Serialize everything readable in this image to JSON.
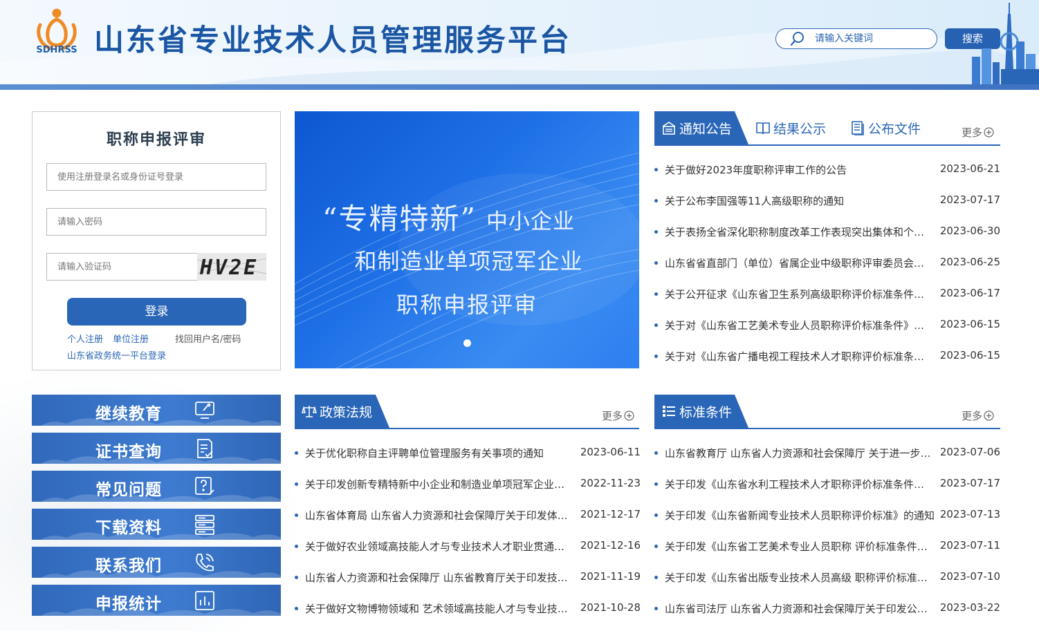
{
  "header": {
    "logo_text": "SDHRSS",
    "title": "山东省专业技术人员管理服务平台",
    "search_placeholder": "请输入关键词",
    "search_button": "搜索"
  },
  "login": {
    "title": "职称申报评审",
    "username_placeholder": "使用注册登录名或身份证号登录",
    "password_placeholder": "请输入密码",
    "captcha_placeholder": "请输入验证码",
    "captcha_text": "HV2E",
    "login_button": "登录",
    "personal_register": "个人注册",
    "unit_register": "单位注册",
    "recover": "找回用户名/密码",
    "gov_login": "山东省政务统一平台登录"
  },
  "side_nav": [
    {
      "label": "继续教育",
      "icon": "online-learning-icon"
    },
    {
      "label": "证书查询",
      "icon": "certificate-check-icon"
    },
    {
      "label": "常见问题",
      "icon": "question-edit-icon"
    },
    {
      "label": "下载资料",
      "icon": "server-stack-icon"
    },
    {
      "label": "联系我们",
      "icon": "phone-icon"
    },
    {
      "label": "申报统计",
      "icon": "bar-chart-icon"
    }
  ],
  "banner": {
    "line1_big": "“专精特新”",
    "line1_small": "中小企业",
    "line2": "和制造业单项冠军企业",
    "line3": "职称申报评审"
  },
  "notices": {
    "tabs": [
      {
        "label": "通知公告",
        "icon": "notice-board-icon",
        "active": true
      },
      {
        "label": "结果公示",
        "icon": "open-book-icon",
        "active": false
      },
      {
        "label": "公布文件",
        "icon": "document-list-icon",
        "active": false
      }
    ],
    "more": "更多",
    "items": [
      {
        "title": "关于做好2023年度职称评审工作的公告",
        "date": "2023-06-21"
      },
      {
        "title": "关于公布李国强等11人高级职称的通知",
        "date": "2023-07-17"
      },
      {
        "title": "关于表扬全省深化职称制度改革工作表现突出集体和个人的通报",
        "date": "2023-06-30"
      },
      {
        "title": "山东省省直部门（单位）省属企业中级职称评审委员会名单",
        "date": "2023-06-25"
      },
      {
        "title": "关于公开征求《山东省卫生系列高级职称评价标准条件》意见的通知",
        "date": "2023-06-17"
      },
      {
        "title": "关于对《山东省工艺美术专业人员职称评价标准条件》征求意见的通知",
        "date": "2023-06-15"
      },
      {
        "title": "关于对《山东省广播电视工程技术人才职称评价标准条件》征求意见",
        "date": "2023-06-15"
      }
    ]
  },
  "policy": {
    "title": "政策法规",
    "icon": "scales-icon",
    "more": "更多",
    "items": [
      {
        "title": "关于优化职称自主评聘单位管理服务有关事项的通知",
        "date": "2023-06-11"
      },
      {
        "title": "关于印发创新专精特新中小企业和制造业单项冠军企业职称评审的通知",
        "date": "2022-11-23"
      },
      {
        "title": "山东省体育局 山东省人力资源和社会保障厅关于印发体育专业人员职称评价",
        "date": "2021-12-17"
      },
      {
        "title": "关于做好农业领域高技能人才与专业技术人才职业贯通工作的通知",
        "date": "2021-12-16"
      },
      {
        "title": "山东省人力资源和社会保障厅 山东省教育厅关于印发技工院校教师职称评价",
        "date": "2021-11-19"
      },
      {
        "title": "关于做好文物博物领域和 艺术领域高技能人才与专业技术人才职业贯通",
        "date": "2021-10-28"
      }
    ]
  },
  "standards": {
    "title": "标准条件",
    "icon": "list-icon",
    "more": "更多",
    "items": [
      {
        "title": "山东省教育厅 山东省人力资源和社会保障厅 关于进一步深化中小学教师职称",
        "date": "2023-07-06"
      },
      {
        "title": "关于印发《山东省水利工程技术人才职称评价标准条件》的通知",
        "date": "2023-07-17"
      },
      {
        "title": "关于印发《山东省新闻专业技术人员职称评价标准》的通知",
        "date": "2023-07-13"
      },
      {
        "title": "关于印发《山东省工艺美术专业人员职称 评价标准条件》的通知",
        "date": "2023-07-11"
      },
      {
        "title": "关于印发《山东省出版专业技术人员高级 职称评价标准条件》的通知",
        "date": "2023-07-10"
      },
      {
        "title": "山东省司法厅 山东省人力资源和社会保障厅关于印发公证员职称评价标准",
        "date": "2023-03-22"
      }
    ]
  },
  "colors": {
    "primary": "#2a66b7",
    "title_blue": "#1a56a4",
    "logo_orange": "#f08a24"
  }
}
